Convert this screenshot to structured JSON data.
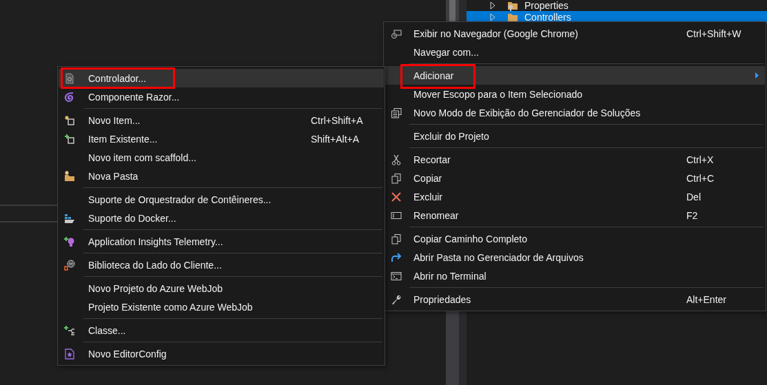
{
  "solution_tree": [
    {
      "label": "Properties",
      "selected": false,
      "kind": "propfolder"
    },
    {
      "label": "Controllers",
      "selected": true,
      "kind": "folder"
    }
  ],
  "context_menu": {
    "groups": [
      [
        {
          "label": "Exibir no Navegador (Google Chrome)",
          "shortcut": "Ctrl+Shift+W",
          "kind": "browser",
          "hovered": false,
          "marked": false,
          "has_submenu": false
        },
        {
          "label": "Navegar com...",
          "kind": "plain",
          "hovered": false,
          "marked": false,
          "has_submenu": false
        }
      ],
      [
        {
          "label": "Adicionar",
          "kind": "plain",
          "hovered": true,
          "marked": true,
          "has_submenu": true
        },
        {
          "label": "Mover Escopo para o Item Selecionado",
          "kind": "plain",
          "hovered": false,
          "marked": false,
          "has_submenu": false
        },
        {
          "label": "Novo Modo de Exibição do Gerenciador de Soluções",
          "kind": "windows",
          "hovered": false,
          "marked": false,
          "has_submenu": false
        }
      ],
      [
        {
          "label": "Excluir do Projeto",
          "kind": "plain",
          "hovered": false,
          "marked": false,
          "has_submenu": false
        }
      ],
      [
        {
          "label": "Recortar",
          "shortcut": "Ctrl+X",
          "kind": "cut",
          "hovered": false,
          "marked": false,
          "has_submenu": false
        },
        {
          "label": "Copiar",
          "shortcut": "Ctrl+C",
          "kind": "copy",
          "hovered": false,
          "marked": false,
          "has_submenu": false
        },
        {
          "label": "Excluir",
          "shortcut": "Del",
          "kind": "delete",
          "hovered": false,
          "marked": false,
          "has_submenu": false
        },
        {
          "label": "Renomear",
          "shortcut": "F2",
          "kind": "rename",
          "hovered": false,
          "marked": false,
          "has_submenu": false
        }
      ],
      [
        {
          "label": "Copiar Caminho Completo",
          "kind": "copy",
          "hovered": false,
          "marked": false,
          "has_submenu": false
        },
        {
          "label": "Abrir Pasta no Gerenciador de Arquivos",
          "kind": "redo",
          "hovered": false,
          "marked": false,
          "has_submenu": false
        },
        {
          "label": "Abrir no Terminal",
          "kind": "terminal",
          "hovered": false,
          "marked": false,
          "has_submenu": false
        }
      ],
      [
        {
          "label": "Propriedades",
          "shortcut": "Alt+Enter",
          "kind": "wrench",
          "hovered": false,
          "marked": false,
          "has_submenu": false
        }
      ]
    ]
  },
  "submenu": {
    "groups": [
      [
        {
          "label": "Controlador...",
          "kind": "document",
          "hovered": true,
          "marked": true
        },
        {
          "label": "Componente Razor...",
          "kind": "razor",
          "hovered": false,
          "marked": false
        }
      ],
      [
        {
          "label": "Novo Item...",
          "shortcut": "Ctrl+Shift+A",
          "kind": "newitem",
          "hovered": false,
          "marked": false
        },
        {
          "label": "Item Existente...",
          "shortcut": "Shift+Alt+A",
          "kind": "existingitem",
          "hovered": false,
          "marked": false
        },
        {
          "label": "Novo item com scaffold...",
          "kind": "plain",
          "hovered": false,
          "marked": false
        },
        {
          "label": "Nova Pasta",
          "kind": "newfolder",
          "hovered": false,
          "marked": false
        }
      ],
      [
        {
          "label": "Suporte de Orquestrador de Contêineres...",
          "kind": "plain",
          "hovered": false,
          "marked": false
        },
        {
          "label": "Suporte do Docker...",
          "kind": "docker",
          "hovered": false,
          "marked": false
        }
      ],
      [
        {
          "label": "Application Insights Telemetry...",
          "kind": "bulb",
          "hovered": false,
          "marked": false
        }
      ],
      [
        {
          "label": "Biblioteca do Lado do Cliente...",
          "kind": "globe",
          "hovered": false,
          "marked": false
        }
      ],
      [
        {
          "label": "Novo Projeto do Azure WebJob",
          "kind": "plain",
          "hovered": false,
          "marked": false
        },
        {
          "label": "Projeto Existente como Azure WebJob",
          "kind": "plain",
          "hovered": false,
          "marked": false
        }
      ],
      [
        {
          "label": "Classe...",
          "kind": "class",
          "hovered": false,
          "marked": false
        }
      ],
      [
        {
          "label": "Novo EditorConfig",
          "kind": "starfile",
          "hovered": false,
          "marked": false
        }
      ]
    ]
  }
}
